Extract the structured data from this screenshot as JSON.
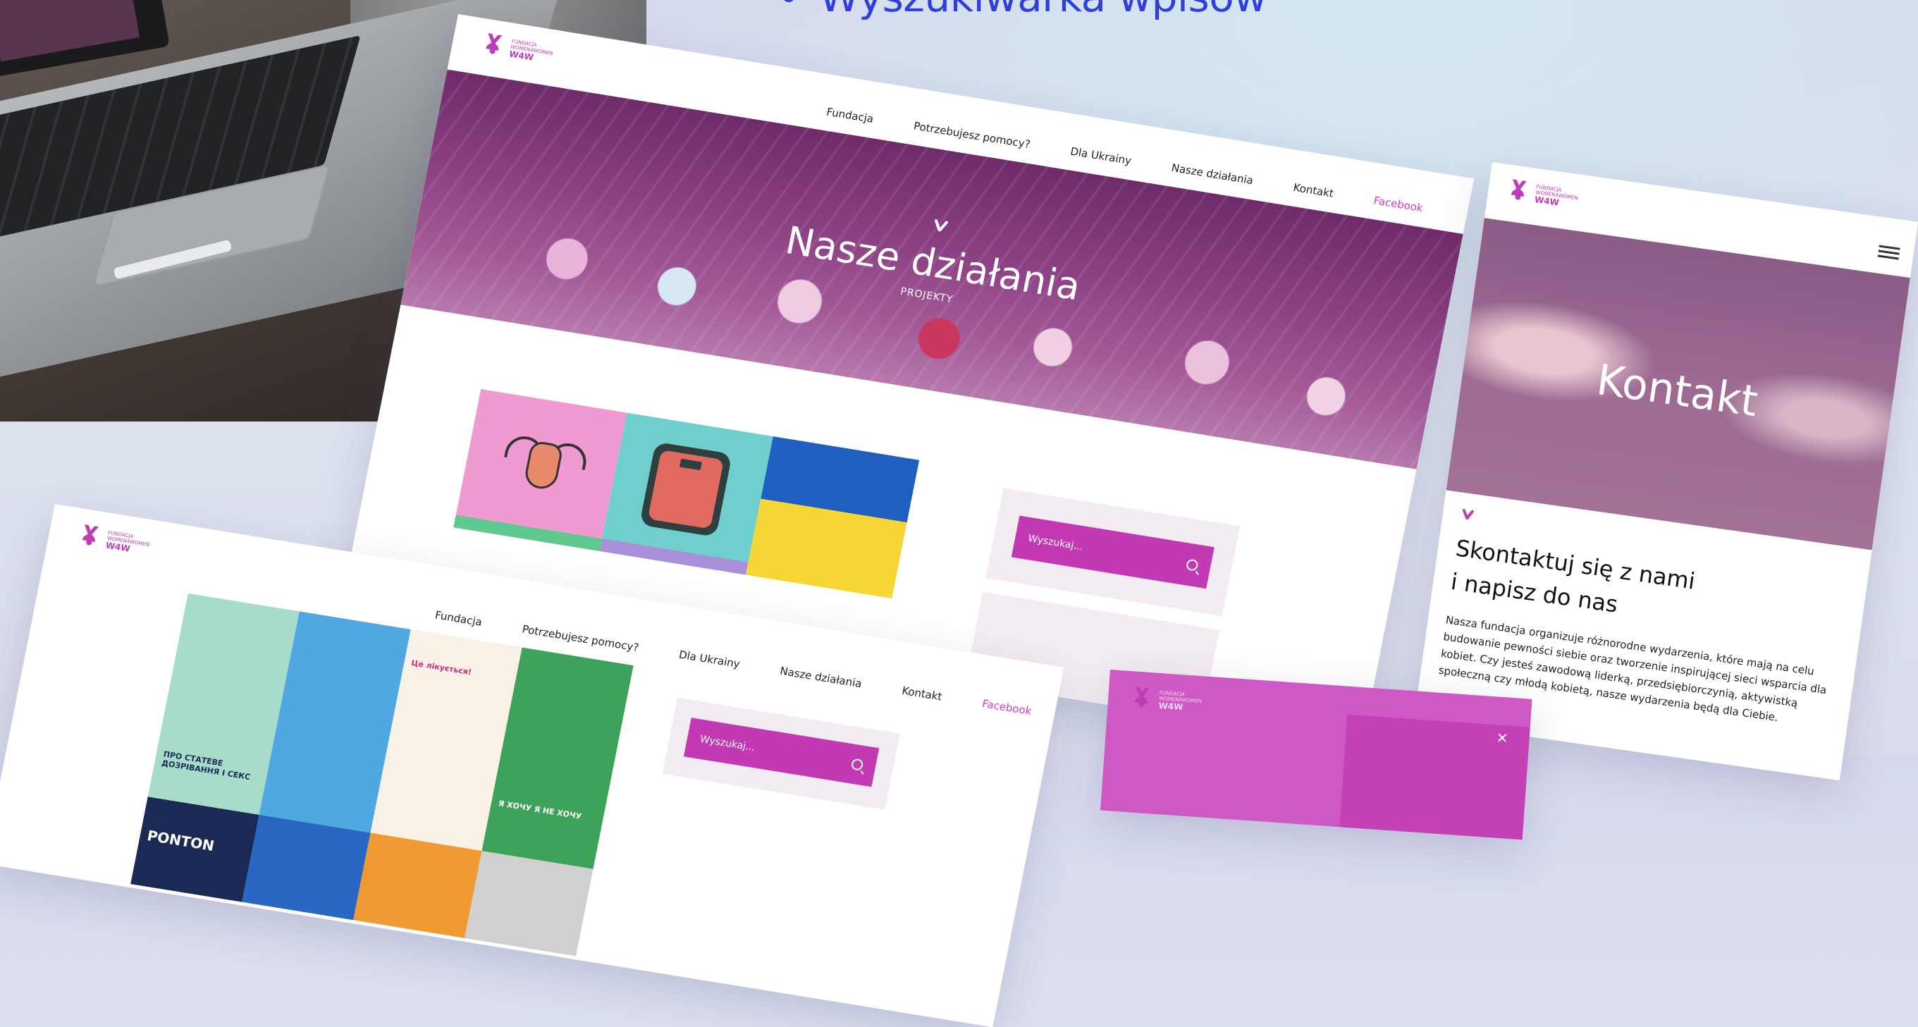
{
  "heading": {
    "text": "Wyszukiwarka wpisów"
  },
  "brand": {
    "line1": "FUNDACJA",
    "line2": "WOMEN4WOMEN",
    "short": "W4W",
    "accent_color": "#c339b3"
  },
  "nav": {
    "items": [
      "Fundacja",
      "Potrzebujesz pomocy?",
      "Dla Ukrainy",
      "Nasze działania",
      "Kontakt"
    ],
    "facebook": "Facebook"
  },
  "main_page": {
    "hero_title": "Nasze działania",
    "hero_subtitle": "PROJEKTY",
    "search_placeholder": "Wyszukaj..."
  },
  "contact_page": {
    "hero_title": "Kontakt",
    "heading_line1": "Skontaktuj się z nami",
    "heading_line2": "i napisz do nas",
    "paragraph": "Nasza fundacja organizuje różnorodne wydarzenia, które mają na celu budowanie pewności siebie oraz tworzenie inspirującej sieci wsparcia dla kobiet. Czy jesteś zawodową liderką, przedsiębiorczynią, aktywistką społeczną czy młodą kobietą, nasze wydarzenia będą dla Ciebie."
  },
  "projects_page": {
    "search_placeholder": "Wyszukaj...",
    "thumbs": [
      {
        "caption": "ПРО СТАТЕВЕ ДОЗРІВАННЯ І СЕКС",
        "footer": "PONTON"
      },
      {
        "caption": ""
      },
      {
        "caption": "Це лікується!"
      },
      {
        "caption": "Я ХОЧУ Я НЕ ХОЧУ"
      }
    ]
  }
}
